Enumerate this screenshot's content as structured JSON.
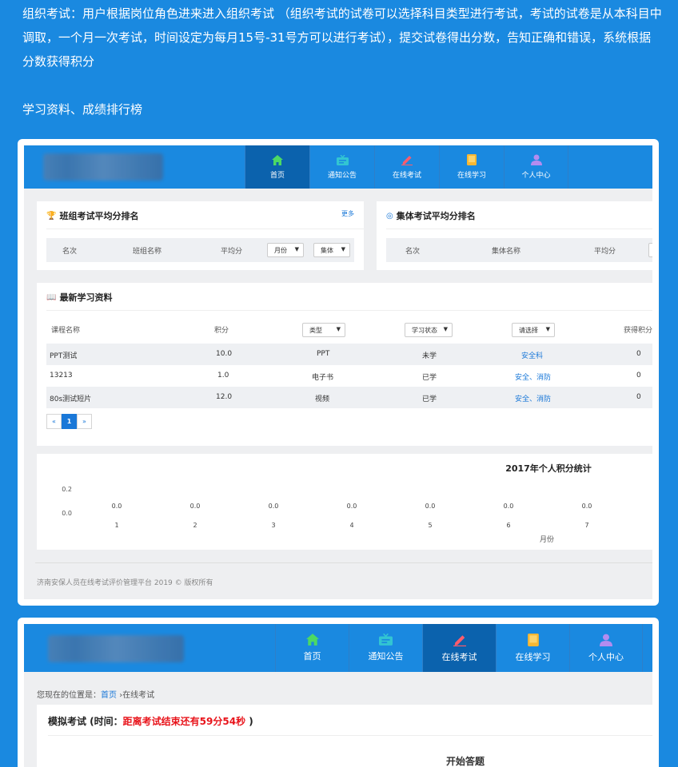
{
  "intro": {
    "paragraph": "组织考试：用户根据岗位角色进来进入组织考试 （组织考试的试卷可以选择科目类型进行考试，考试的试卷是从本科目中调取，一个月一次考试，时间设定为每月15号-31号方可以进行考试），提交试卷得出分数，告知正确和错误，系统根据分数获得积分",
    "learning": "学习资料、成绩排行榜"
  },
  "nav": {
    "items": [
      {
        "label": "首页",
        "icon": "home-icon",
        "color": "#4cd964"
      },
      {
        "label": "通知公告",
        "icon": "notice-icon",
        "color": "#32c5d2"
      },
      {
        "label": "在线考试",
        "icon": "pencil-icon",
        "color": "#ff5c6c"
      },
      {
        "label": "在线学习",
        "icon": "book-icon",
        "color": "#f7b733"
      },
      {
        "label": "个人中心",
        "icon": "user-icon",
        "color": "#b38cf0"
      }
    ]
  },
  "team_rank": {
    "title": "班组考试平均分排名",
    "more": "更多",
    "cols": [
      "名次",
      "班组名称",
      "平均分"
    ],
    "month_select": "月份",
    "group_select": "集体"
  },
  "group_rank": {
    "title": "集体考试平均分排名",
    "cols": [
      "名次",
      "集体名称",
      "平均分"
    ]
  },
  "materials": {
    "title": "最新学习资料",
    "cols": {
      "name": "课程名称",
      "points": "积分",
      "type_select": "类型",
      "status_select": "学习状态",
      "category_select": "请选择",
      "earned": "获得积分"
    },
    "rows": [
      {
        "name": "PPT测试",
        "points": "10.0",
        "type": "PPT",
        "status": "未学",
        "category": "安全科",
        "earned": "0"
      },
      {
        "name": "13213",
        "points": "1.0",
        "type": "电子书",
        "status": "已学",
        "category": "安全、消防",
        "earned": "0"
      },
      {
        "name": "80s测试短片",
        "points": "12.0",
        "type": "视频",
        "status": "已学",
        "category": "安全、消防",
        "earned": "0"
      }
    ],
    "pager": {
      "prev": "«",
      "current": "1",
      "next": "»"
    }
  },
  "chart_data": {
    "type": "line",
    "title": "2017年个人积分统计",
    "xlabel": "月份",
    "ylabel": "",
    "x": [
      "1",
      "2",
      "3",
      "4",
      "5",
      "6",
      "7"
    ],
    "series": [
      {
        "values": [
          0.0,
          0.0,
          0.0,
          0.0,
          0.0,
          0.0,
          0.0
        ]
      }
    ],
    "data_labels": [
      "0.0",
      "0.0",
      "0.0",
      "0.0",
      "0.0",
      "0.0",
      "0.0"
    ],
    "yticks": [
      "0.2",
      "0.0"
    ],
    "ylim": [
      0,
      0.2
    ]
  },
  "footer": "济南安保人员在线考试评价管理平台 2019 © 版权所有",
  "exam": {
    "crumb_prefix": "您现在的位置是：",
    "crumb_home": "首页",
    "crumb_sep": "›",
    "crumb_current": "在线考试",
    "title_prefix": "模拟考试 (时间：",
    "countdown": "距离考试结束还有59分54秒",
    "title_suffix": ")",
    "start": "开始答题"
  }
}
